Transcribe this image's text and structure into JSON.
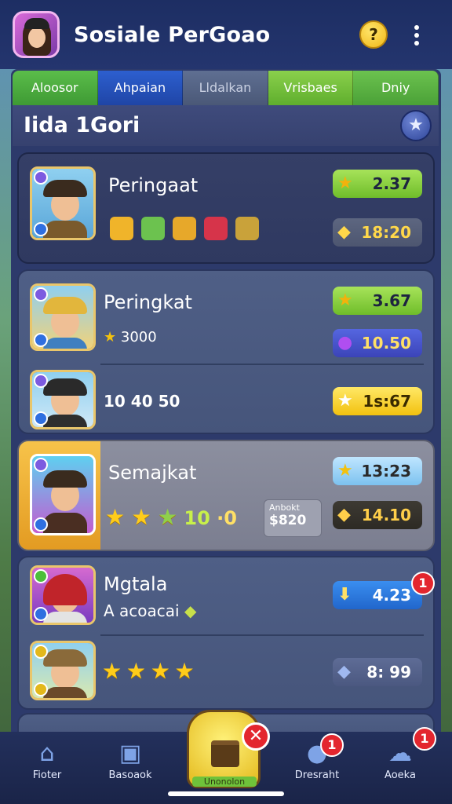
{
  "header": {
    "title": "Sosiale PerGoao",
    "help_symbol": "?",
    "avatar_icon": "player-avatar",
    "help_icon": "question-icon",
    "more_icon": "more-vertical-icon"
  },
  "tabs": [
    {
      "label": "Aloosor"
    },
    {
      "label": "Ahpaian"
    },
    {
      "label": "Lldalkan"
    },
    {
      "label": "Vrisbaes"
    },
    {
      "label": "Dniy"
    }
  ],
  "section": {
    "title": "Iida 1Gori",
    "star_symbol": "★"
  },
  "cards": [
    {
      "name": "Peringaat",
      "score": "2.37",
      "time": "18:20"
    },
    {
      "name": "Peringkat",
      "subline": "3000",
      "score": "3.67",
      "badge_value": "10.50",
      "row2_text": "10 40 50",
      "row2_value": "1s:67"
    },
    {
      "name": "Semajkat",
      "stars_text": "10",
      "stars_text2": "·0",
      "time": "13:23",
      "box_label": "Anbokt",
      "box_value": "$820",
      "value2": "14.10"
    },
    {
      "name": "Mgtala",
      "subline": "A acoacai",
      "value": "4.23",
      "badge": "1",
      "row2_value": "8: 99"
    }
  ],
  "bottom_nav": [
    {
      "label": "Fioter",
      "icon": "home-icon"
    },
    {
      "label": "Basoaok",
      "icon": "document-icon"
    },
    {
      "label": "Unonolon",
      "icon": "crate-icon"
    },
    {
      "label": "Dresraht",
      "icon": "person-icon",
      "badge": "1"
    },
    {
      "label": "Aoeka",
      "icon": "group-icon",
      "badge": "1"
    }
  ],
  "center_close_symbol": "✕",
  "colors": {
    "header_bg": "#1d2e63",
    "panel_bg": "#2d3a6b",
    "accent_yellow": "#f2c10f",
    "accent_green": "#6fbd2a",
    "badge_red": "#e3262e"
  }
}
